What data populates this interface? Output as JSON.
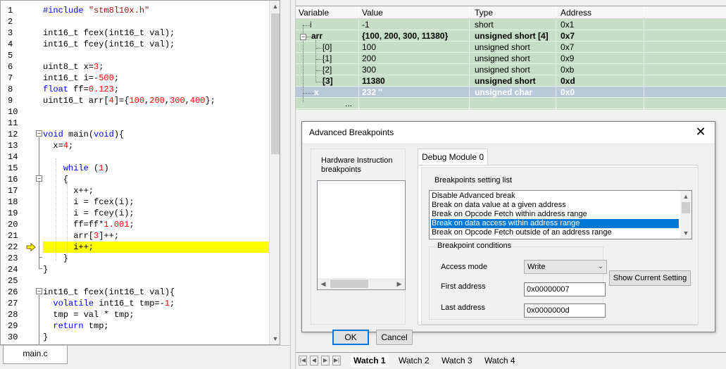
{
  "editor": {
    "lines": [
      {
        "n": "1",
        "html": "<span class='kw'>#include</span> <span class='str'>\"stm8l10x.h\"</span>"
      },
      {
        "n": "2",
        "html": ""
      },
      {
        "n": "3",
        "html": "int16_t fcex(int16_t val);"
      },
      {
        "n": "4",
        "html": "int16_t fcey(int16_t val);"
      },
      {
        "n": "5",
        "html": ""
      },
      {
        "n": "6",
        "html": "uint8_t x=<span class='num'>3</span>;"
      },
      {
        "n": "7",
        "html": "int16_t i=-<span class='num'>500</span>;"
      },
      {
        "n": "8",
        "html": "<span class='kw'>float</span> ff=<span class='num'>0.123</span>;"
      },
      {
        "n": "9",
        "html": "uint16_t arr[<span class='num'>4</span>]={<span class='num'>100</span>,<span class='num'>200</span>,<span class='num'>300</span>,<span class='num'>400</span>};"
      },
      {
        "n": "10",
        "html": ""
      },
      {
        "n": "11",
        "html": ""
      },
      {
        "n": "12",
        "html": "<span class='kw'>void</span> main(<span class='kw'>void</span>){"
      },
      {
        "n": "13",
        "html": "  x=<span class='num'>4</span>;"
      },
      {
        "n": "14",
        "html": ""
      },
      {
        "n": "15",
        "html": "    <span class='kw'>while</span> (<span class='num'>1</span>)"
      },
      {
        "n": "16",
        "html": "    {"
      },
      {
        "n": "17",
        "html": "      x++;"
      },
      {
        "n": "18",
        "html": "      i = fcex(i);"
      },
      {
        "n": "19",
        "html": "      i = fcey(i);"
      },
      {
        "n": "20",
        "html": "      ff=ff*<span class='num'>1.001</span>;"
      },
      {
        "n": "21",
        "html": "      arr[<span class='num'>3</span>]++;"
      },
      {
        "n": "22",
        "html": "      i++;"
      },
      {
        "n": "23",
        "html": "    }"
      },
      {
        "n": "24",
        "html": "}"
      },
      {
        "n": "25",
        "html": ""
      },
      {
        "n": "26",
        "html": "int16_t fcex(int16_t val){"
      },
      {
        "n": "27",
        "html": "  <span class='kw'>volatile</span> int16_t tmp=-<span class='num'>1</span>;"
      },
      {
        "n": "28",
        "html": "  tmp = val * tmp;"
      },
      {
        "n": "29",
        "html": "  <span class='kw'>return</span> tmp;"
      },
      {
        "n": "30",
        "html": "}"
      }
    ],
    "current_line": "22",
    "file_tab": "main.c"
  },
  "watch": {
    "title": "Watch",
    "columns": [
      "Variable",
      "Value",
      "Type",
      "Address"
    ],
    "rows": [
      {
        "var": "i",
        "value": "-1",
        "type": "short",
        "addr": "0x1",
        "bold": false,
        "sel": false
      },
      {
        "var": "arr",
        "value": "{100, 200, 300, 11380}",
        "type": "unsigned short [4]",
        "addr": "0x7",
        "bold": true,
        "sel": false
      },
      {
        "var": "[0]",
        "value": "100",
        "type": "unsigned short",
        "addr": "0x7",
        "bold": false,
        "sel": false
      },
      {
        "var": "[1]",
        "value": "200",
        "type": "unsigned short",
        "addr": "0x9",
        "bold": false,
        "sel": false
      },
      {
        "var": "[2]",
        "value": "300",
        "type": "unsigned short",
        "addr": "0xb",
        "bold": false,
        "sel": false
      },
      {
        "var": "[3]",
        "value": "11380",
        "type": "unsigned short",
        "addr": "0xd",
        "bold": true,
        "sel": false
      },
      {
        "var": "x",
        "value": "232 ''",
        "type": "unsigned char",
        "addr": "0x0",
        "bold": false,
        "sel": true
      },
      {
        "var": "...",
        "value": "",
        "type": "",
        "addr": "",
        "bold": false,
        "sel": false
      }
    ],
    "tabs": [
      "Watch 1",
      "Watch 2",
      "Watch 3",
      "Watch 4"
    ],
    "active_tab": "Watch 1"
  },
  "dialog": {
    "title": "Advanced Breakpoints",
    "hw_label": "Hardware Instruction breakpoints",
    "ok": "OK",
    "cancel": "Cancel",
    "tab": "Debug Module 0",
    "list_label": "Breakpoints setting list",
    "list_items": [
      "Disable Advanced break",
      "Break on data value at a given address",
      "Break on Opcode Fetch within address range",
      "Break on data access within address range",
      "Break on Opcode Fetch outside of an address range"
    ],
    "selected_item": 3,
    "conditions_label": "Breakpoint conditions",
    "access_mode_label": "Access mode",
    "access_mode_value": "Write",
    "first_address_label": "First address",
    "first_address_value": "0x00000007",
    "last_address_label": "Last address",
    "last_address_value": "0x0000000d",
    "show_button": "Show Current Setting"
  },
  "colors": {
    "watch_bg": "#c6dec6",
    "current_line": "#ffff00",
    "selection": "#0078d7",
    "keyword": "#0000ff",
    "number": "#ff0000"
  }
}
